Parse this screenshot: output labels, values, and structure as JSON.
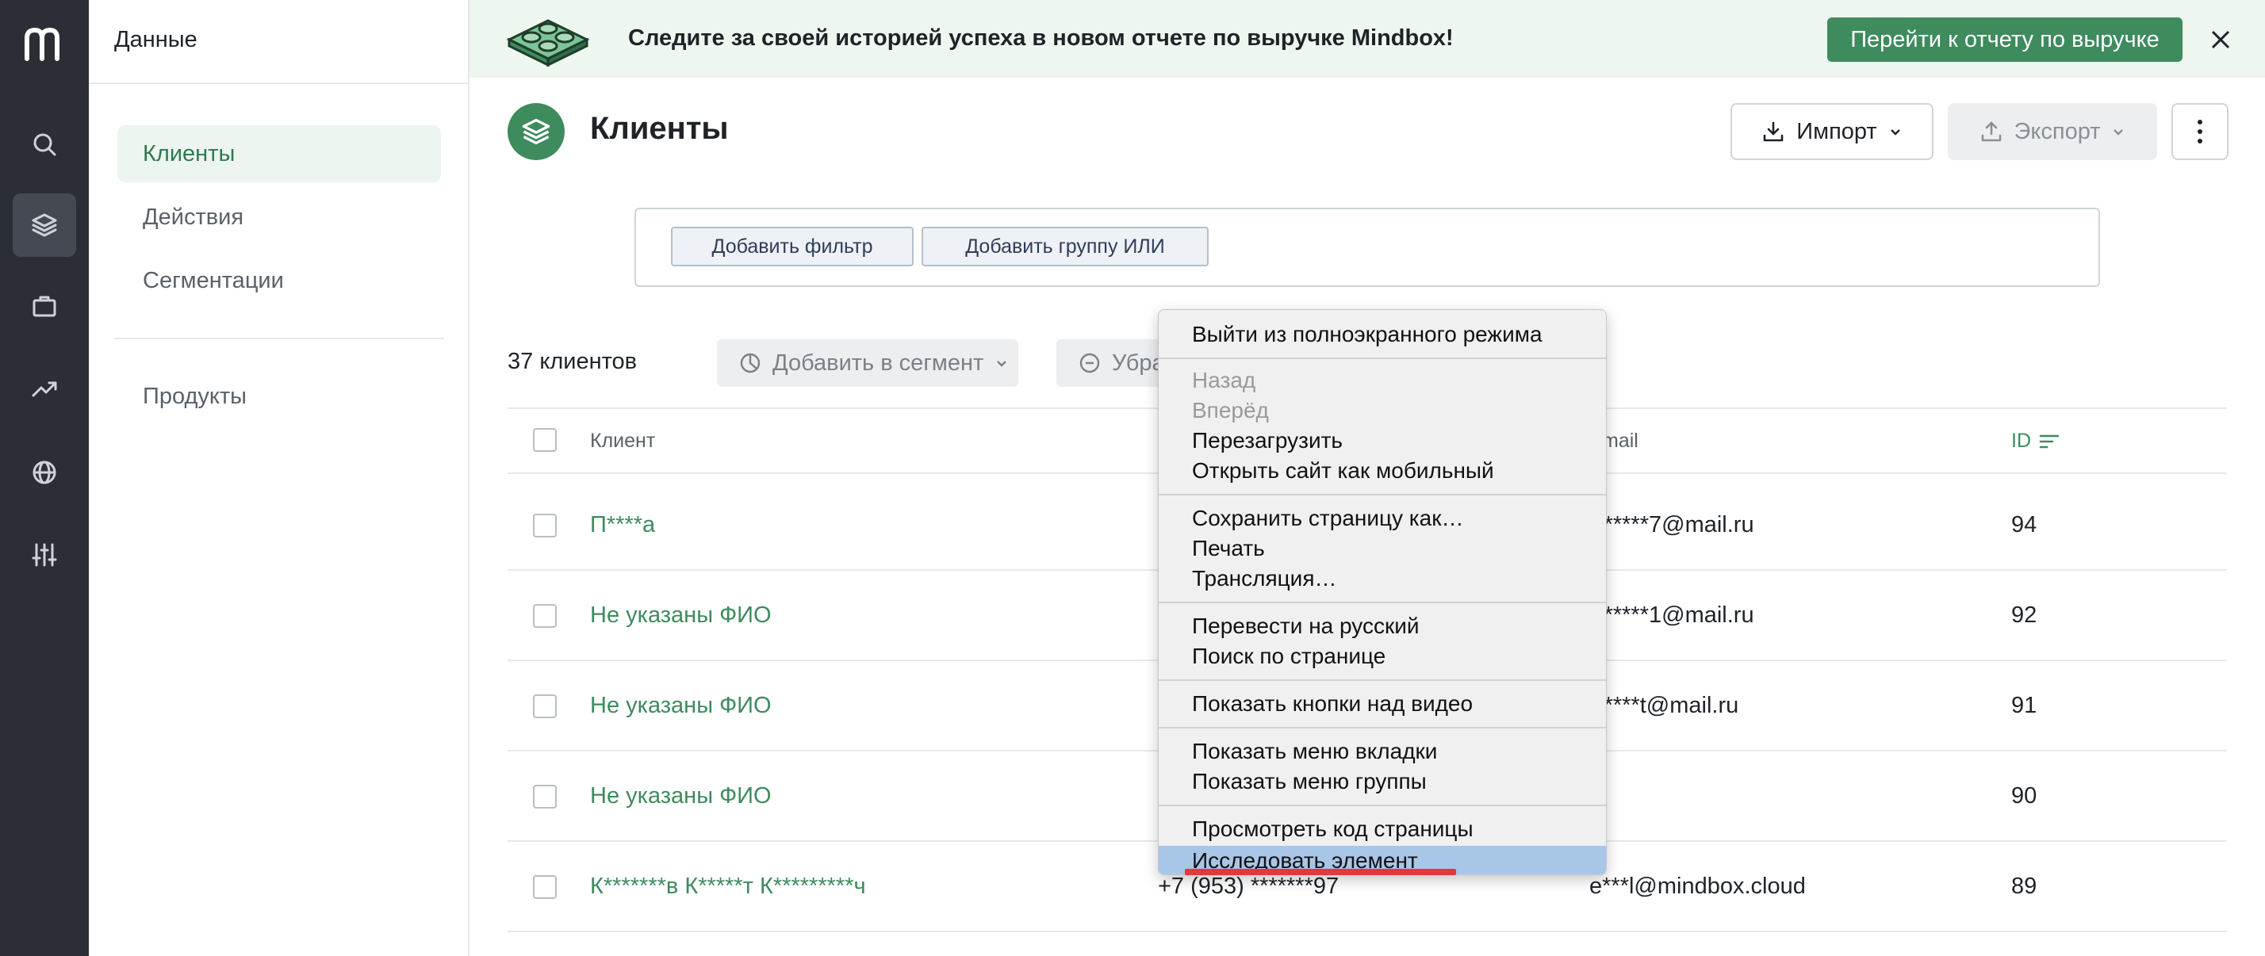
{
  "rail": {
    "logo_letter": "m",
    "items": [
      "search-icon",
      "layers-icon",
      "briefcase-icon",
      "trend-icon",
      "globe-icon",
      "sliders-icon"
    ],
    "active": "layers-icon"
  },
  "nav": {
    "title": "Данные",
    "items": [
      {
        "label": "Клиенты",
        "active": true
      },
      {
        "label": "Действия",
        "active": false
      },
      {
        "label": "Сегментации",
        "active": false
      },
      {
        "label": "Продукты",
        "active": false
      }
    ]
  },
  "banner": {
    "text": "Следите за своей историей успеха в новом отчете по выручке Mindbox!",
    "cta_label": "Перейти к отчету по выручке"
  },
  "header": {
    "title": "Клиенты",
    "import_label": "Импорт",
    "export_label": "Экспорт"
  },
  "filter": {
    "add_filter_label": "Добавить фильтр",
    "add_group_label": "Добавить группу ИЛИ"
  },
  "toolbar": {
    "count_text": "37 клиентов",
    "add_to_segment_label": "Добавить в сегмент",
    "remove_label_partial": "Убра"
  },
  "table": {
    "columns": {
      "client": "Клиент",
      "email_partial": "mail",
      "id": "ID"
    },
    "rows": [
      {
        "client": "П****а",
        "phone": "",
        "email": "*******7@mail.ru",
        "id": "94"
      },
      {
        "client": "Не указаны ФИО",
        "phone": "",
        "email": "*******1@mail.ru",
        "id": "92"
      },
      {
        "client": "Не указаны ФИО",
        "phone": "",
        "email": "******t@mail.ru",
        "id": "91"
      },
      {
        "client": "Не указаны ФИО",
        "phone": "",
        "email": "-",
        "id": "90"
      },
      {
        "client": "К*******в К*****т К*********ч",
        "phone": "+7 (953) *******97",
        "email": "e***l@mindbox.cloud",
        "id": "89"
      }
    ]
  },
  "context_menu": {
    "exit_fullscreen": "Выйти из полноэкранного режима",
    "back": "Назад",
    "forward": "Вперёд",
    "reload": "Перезагрузить",
    "open_mobile": "Открыть сайт как мобильный",
    "save_as": "Сохранить страницу как…",
    "print": "Печать",
    "cast": "Трансляция…",
    "translate": "Перевести на русский",
    "find": "Поиск по странице",
    "video_buttons": "Показать кнопки над видео",
    "tab_menu": "Показать меню вкладки",
    "group_menu": "Показать меню группы",
    "view_source": "Просмотреть код страницы",
    "inspect": "Исследовать элемент"
  },
  "colors": {
    "accent": "#3e8b5e",
    "rail_bg": "#2b2f35",
    "highlight": "#a8c6e8",
    "annotation": "#e53935"
  }
}
